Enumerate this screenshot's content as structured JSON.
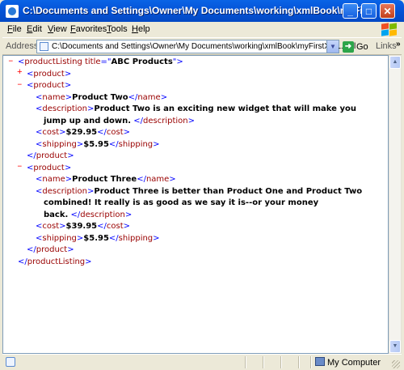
{
  "window": {
    "title": "C:\\Documents and Settings\\Owner\\My Documents\\working\\xmlBook\\myFirstXML.xml - Micr...",
    "minimize_glyph": "_",
    "maximize_glyph": "□",
    "close_glyph": "✕"
  },
  "menu": {
    "items": [
      {
        "ul": "F",
        "rest": "ile"
      },
      {
        "ul": "E",
        "rest": "dit"
      },
      {
        "ul": "V",
        "rest": "iew"
      },
      {
        "ul": "F",
        "rest": "avorites",
        "pre": ""
      },
      {
        "ul": "T",
        "rest": "ools"
      },
      {
        "ul": "H",
        "rest": "elp"
      }
    ]
  },
  "address": {
    "label": "Address",
    "value": "C:\\Documents and Settings\\Owner\\My Documents\\working\\xmlBook\\myFirstXML.xml",
    "go_label": "Go",
    "links_label": "Links",
    "links_chevron": "»"
  },
  "xml": {
    "root_open": "productListing",
    "root_attr_name": "title",
    "root_attr_value": "ABC Products",
    "collapsed_product": "product",
    "products": [
      {
        "name": "Product Two",
        "description_line1": "Product Two is an exciting new widget that will make you",
        "description_line2": "jump up and down.",
        "cost": "$29.95",
        "shipping": "$5.95"
      },
      {
        "name": "Product Three",
        "description_line1": "Product Three is better than Product One and Product Two",
        "description_line2": "combined! It really is as good as we say it is--or your money",
        "description_line3": "back.",
        "cost": "$39.95",
        "shipping": "$5.95"
      }
    ],
    "tags": {
      "product": "product",
      "name": "name",
      "description": "description",
      "cost": "cost",
      "shipping": "shipping"
    },
    "expanded_marker": "–",
    "collapsed_marker": "+"
  },
  "status": {
    "zone": "My Computer"
  }
}
